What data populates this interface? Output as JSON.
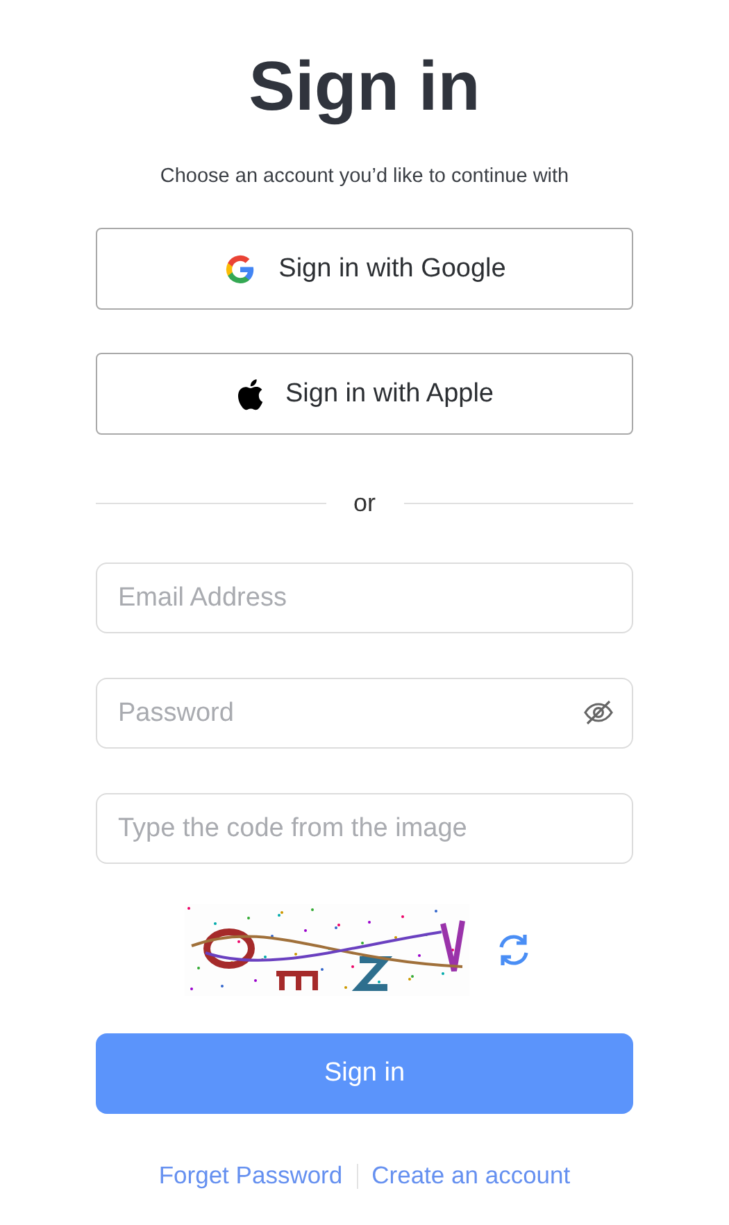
{
  "title": "Sign in",
  "subtitle": "Choose an account you’d like to continue with",
  "providers": [
    {
      "kind": "google",
      "label": "Sign in with Google"
    },
    {
      "kind": "apple",
      "label": "Sign in with Apple"
    }
  ],
  "divider": "or",
  "fields": [
    {
      "kind": "email",
      "placeholder": "Email Address"
    },
    {
      "kind": "password",
      "placeholder": "Password"
    },
    {
      "kind": "captcha",
      "placeholder": "Type the code from the image"
    }
  ],
  "captcha": {
    "kind": "picture"
  },
  "submit": "Sign in",
  "links": [
    "Forget Password",
    "Create an account"
  ]
}
